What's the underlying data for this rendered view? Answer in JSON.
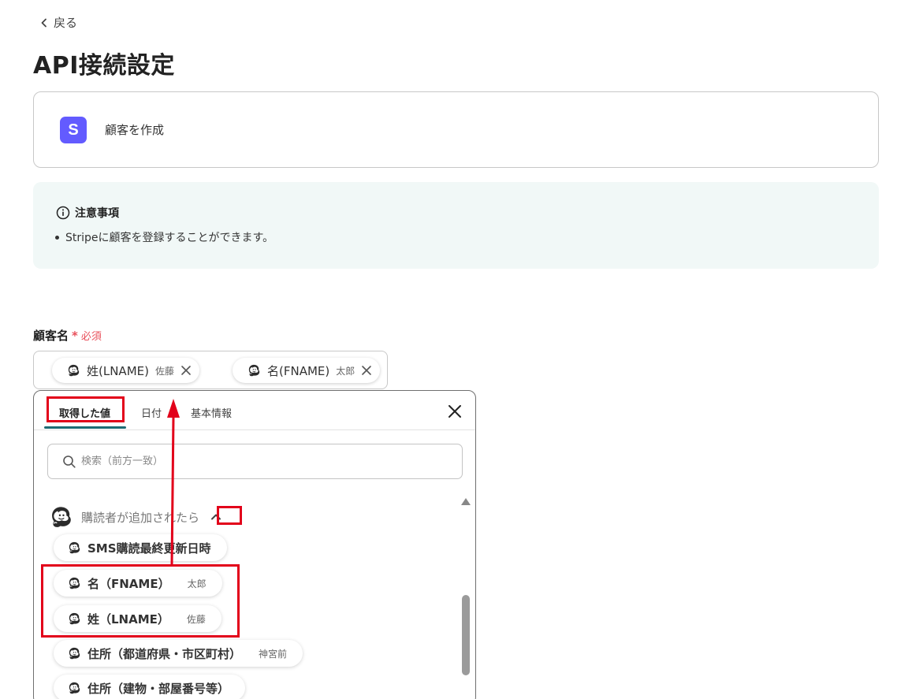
{
  "nav": {
    "back_label": "戻る"
  },
  "page": {
    "title": "API接続設定"
  },
  "app": {
    "logo_letter": "S",
    "action": "顧客を作成"
  },
  "notice": {
    "heading": "注意事項",
    "items": [
      "Stripeに顧客を登録することができます。"
    ]
  },
  "field": {
    "label": "顧客名",
    "required_star": "*",
    "required_text": "必須",
    "chips": [
      {
        "label": "姓(LNAME)",
        "value": "佐藤"
      },
      {
        "label": "名(FNAME)",
        "value": "太郎"
      }
    ]
  },
  "picker": {
    "tabs": [
      "取得した値",
      "日付",
      "基本情報"
    ],
    "active_tab": "取得した値",
    "search_placeholder": "検索（前方一致）",
    "group_title": "購読者が追加されたら",
    "items": [
      {
        "label": "SMS購読最終更新日時",
        "value": ""
      },
      {
        "label": "名（FNAME）",
        "value": "太郎"
      },
      {
        "label": "姓（LNAME）",
        "value": "佐藤"
      },
      {
        "label": "住所（都道府県・市区町村）",
        "value": "神宮前"
      },
      {
        "label": "住所（建物・部屋番号等）",
        "value": ""
      }
    ]
  },
  "colors": {
    "accent_tab": "#1d6b73",
    "stripe": "#635bff",
    "annotation": "#e2001a",
    "required": "#e8505b",
    "notice_bg": "#f1f8f7"
  }
}
